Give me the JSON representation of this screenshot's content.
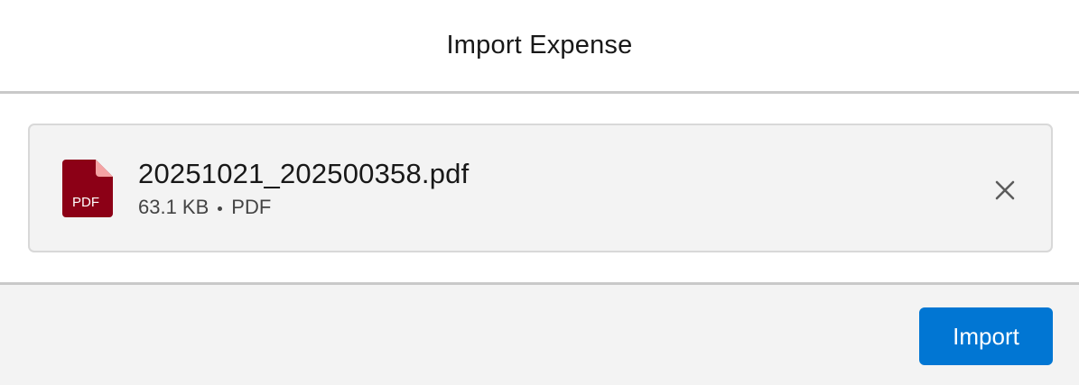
{
  "modal": {
    "title": "Import Expense"
  },
  "file": {
    "icon": "pdf-file-icon",
    "icon_label": "PDF",
    "name": "20251021_202500358.pdf",
    "size": "63.1 KB",
    "type": "PDF",
    "remove_icon": "close-icon"
  },
  "footer": {
    "import_label": "Import"
  },
  "colors": {
    "primary": "#0176d3",
    "pdf_icon": "#8c0016",
    "pdf_fold": "#f4a3a3",
    "card_bg": "#f3f3f3",
    "divider": "#c9c9c9"
  }
}
